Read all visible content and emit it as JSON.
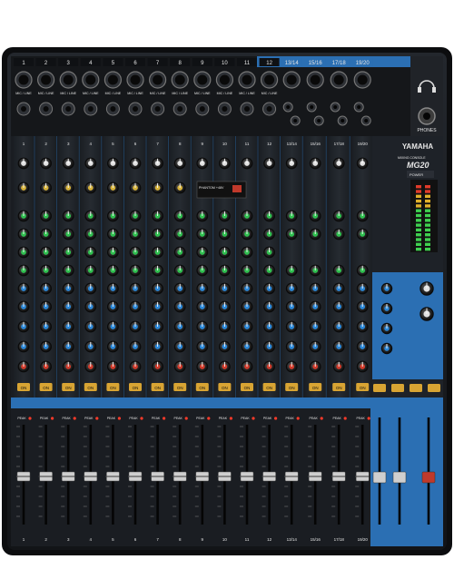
{
  "brand": "YAMAHA",
  "model_caption": "MIXING CONSOLE",
  "model": "MG20",
  "input_label": "MIC / LINE",
  "input_numbers": [
    "1",
    "2",
    "3",
    "4",
    "5",
    "6",
    "7",
    "8",
    "9",
    "10",
    "11",
    "12",
    "13/14",
    "15/16",
    "17/18",
    "19/20"
  ],
  "phones_label": "PHONES",
  "power_label": "POWER",
  "on_label": "ON",
  "peak_label": "PEAK",
  "phantom_label": "PHANTOM +48V",
  "colors": {
    "chassis": "#16181c",
    "panel": "#1e2228",
    "accent_blue": "#2b6fb3",
    "knob_green": "#2fbf4f",
    "knob_blue": "#2a86d6",
    "knob_red": "#d03a2a",
    "knob_yellow": "#d6b23a",
    "on_button": "#d8a433"
  },
  "icons": [
    "headphones-icon",
    "yamaha-logo"
  ]
}
